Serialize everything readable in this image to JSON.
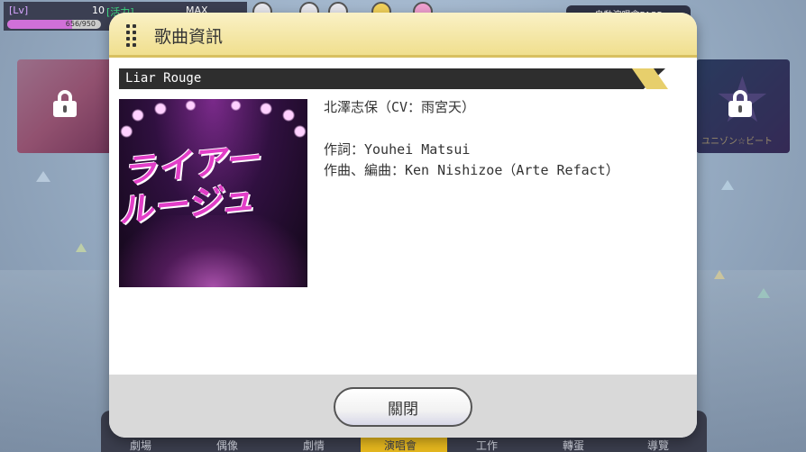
{
  "hud": {
    "level_label": "[Lv]",
    "level_value": "10",
    "stamina_label": "[活力]",
    "stamina_max": "MAX",
    "exp_text": "656/950",
    "exp_progress": 0.69,
    "right_panel_text": "自動演唱會PASS"
  },
  "side_banners": {
    "right_text": "ユニゾン☆ビート"
  },
  "dialog": {
    "title": "歌曲資訊",
    "song_name": "Liar Rouge",
    "jacket_title": "ライアー ルージュ",
    "artist": "北澤志保（CV：雨宮天）",
    "lyrics": "作詞：Youhei Matsui",
    "composer": "作曲、編曲：Ken Nishizoe（Arte Refact）",
    "close_label": "關閉"
  },
  "bottom_nav": {
    "items": [
      "劇場",
      "偶像",
      "劇情",
      "演唱會",
      "工作",
      "轉蛋",
      "導覽"
    ],
    "active_index": 3,
    "active_color": "#e6b81e"
  },
  "colors": {
    "header_bg": "#f0df8e",
    "footer_bg": "#d9d9d9",
    "song_bar": "#2e2e2e"
  }
}
